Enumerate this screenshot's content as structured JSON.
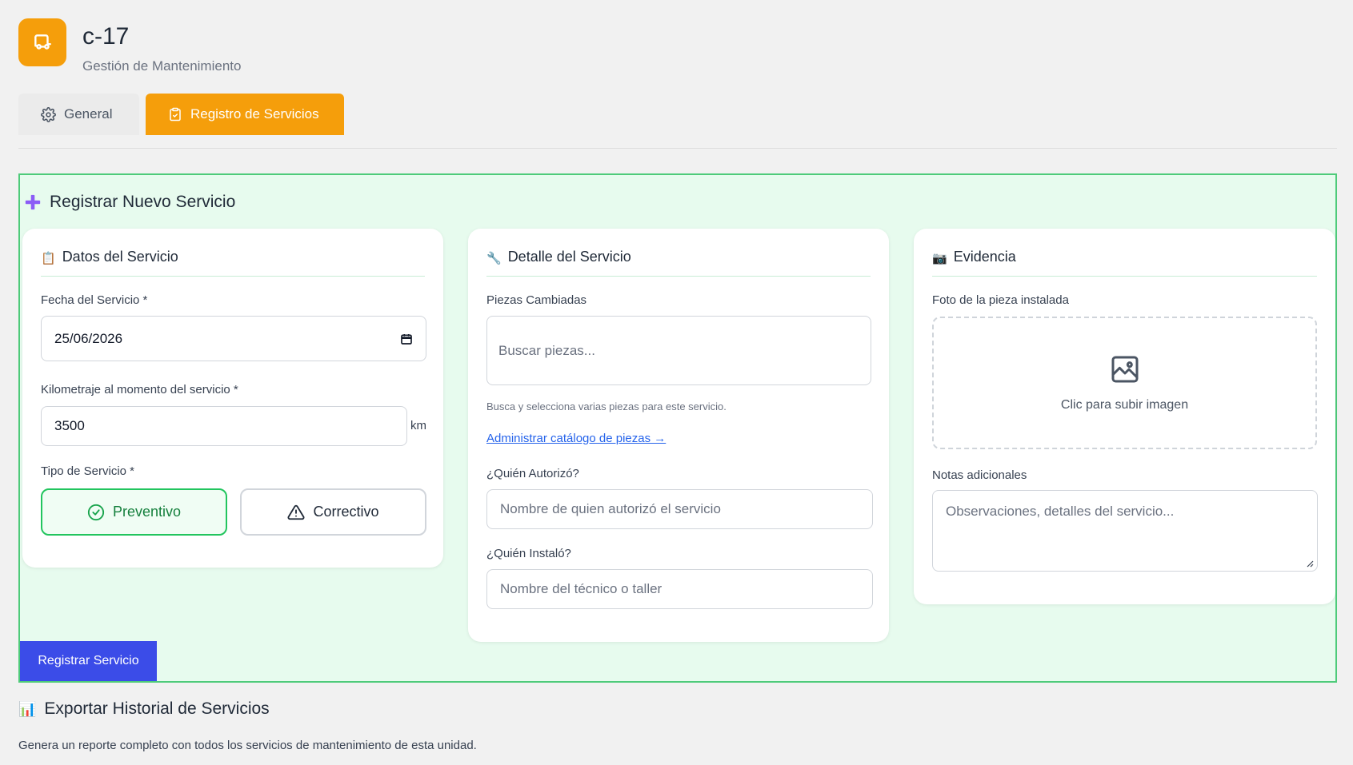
{
  "header": {
    "unit_name": "c-17",
    "subtitle": "Gestión de Mantenimiento",
    "logo_icon": "bus-icon"
  },
  "tabs": [
    {
      "label": "General",
      "icon": "gear-icon",
      "active": false
    },
    {
      "label": "Registro de Servicios",
      "icon": "clipboard-check-icon",
      "active": true
    }
  ],
  "panel": {
    "title": "Registrar Nuevo Servicio",
    "submit_label": "Registrar Servicio"
  },
  "datos": {
    "title": "Datos del Servicio",
    "emoji": "📋",
    "fecha_label": "Fecha del Servicio *",
    "fecha_value": "25/06/2026",
    "km_label": "Kilometraje al momento del servicio *",
    "km_value": "3500",
    "km_unit": "km",
    "tipo_label": "Tipo de Servicio *",
    "preventivo": "Preventivo",
    "correctivo": "Correctivo"
  },
  "detalle": {
    "title": "Detalle del Servicio",
    "emoji": "🔧",
    "piezas_label": "Piezas Cambiadas",
    "piezas_placeholder": "Buscar piezas...",
    "piezas_hint": "Busca y selecciona varias piezas para este servicio.",
    "catalog_link": "Administrar catálogo de piezas →",
    "autorizo_label": "¿Quién Autorizó?",
    "autorizo_placeholder": "Nombre de quien autorizó el servicio",
    "instalo_label": "¿Quién Instaló?",
    "instalo_placeholder": "Nombre del técnico o taller"
  },
  "evidencia": {
    "title": "Evidencia",
    "emoji": "📷",
    "foto_label": "Foto de la pieza instalada",
    "upload_text": "Clic para subir imagen",
    "notas_label": "Notas adicionales",
    "notas_placeholder": "Observaciones, detalles del servicio..."
  },
  "export": {
    "emoji": "📊",
    "title": "Exportar Historial de Servicios",
    "description": "Genera un reporte completo con todos los servicios de mantenimiento de esta unidad."
  },
  "colors": {
    "accent": "#f59e0b",
    "panel_bg": "#e7fbee",
    "panel_border": "#4ecb7a",
    "primary_button": "#3b4ce8",
    "success": "#22c55e"
  }
}
